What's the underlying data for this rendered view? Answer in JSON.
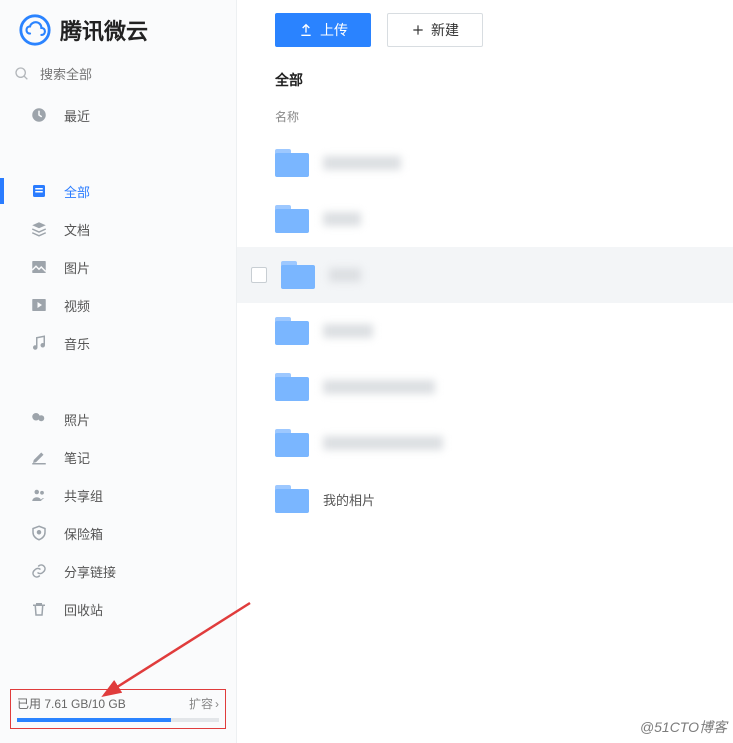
{
  "brand": {
    "name": "腾讯微云"
  },
  "search": {
    "placeholder": "搜索全部"
  },
  "nav": {
    "recent": "最近",
    "all": "全部",
    "docs": "文档",
    "pics": "图片",
    "video": "视频",
    "music": "音乐",
    "photo": "照片",
    "note": "笔记",
    "share_group": "共享组",
    "safe_box": "保险箱",
    "share_link": "分享链接",
    "recycle": "回收站"
  },
  "storage": {
    "text": "已用 7.61 GB/10 GB",
    "expand": "扩容",
    "used_gb": 7.61,
    "total_gb": 10,
    "percent": 76.1
  },
  "toolbar": {
    "upload": "上传",
    "create": "新建"
  },
  "list": {
    "title": "全部",
    "column_name": "名称",
    "rows": [
      {
        "label": "▇▇▇▇",
        "blur_w": 78
      },
      {
        "label": "▇▇",
        "blur_w": 38
      },
      {
        "label": "▇▇",
        "blur_w": 32,
        "hover": true
      },
      {
        "label": "▇▇▇",
        "blur_w": 50
      },
      {
        "label": "▇▇▇▇▇▇",
        "blur_w": 112
      },
      {
        "label": "▇▇▇▇▇▇",
        "blur_w": 120
      },
      {
        "label": "我的相片",
        "blur_w": 0
      }
    ]
  },
  "watermark": "@51CTO博客"
}
